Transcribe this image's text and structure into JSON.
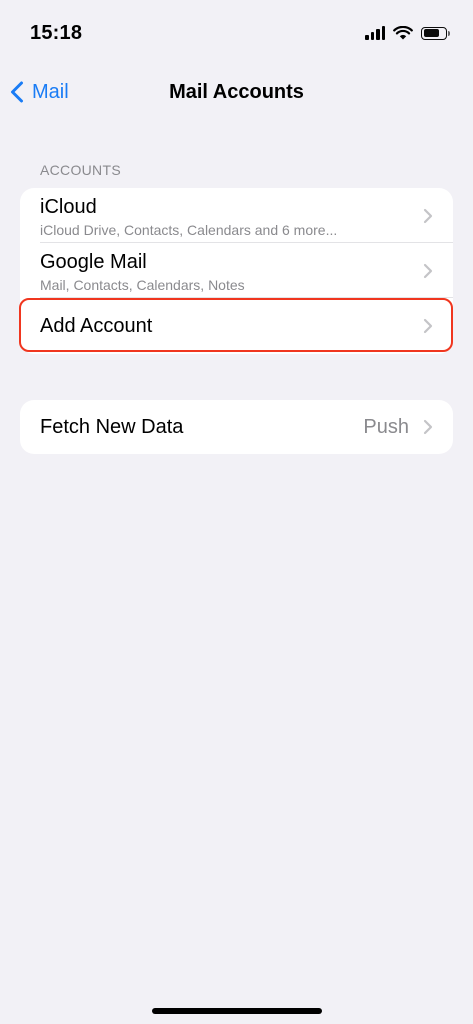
{
  "status_bar": {
    "time": "15:18",
    "icons": [
      "cellular-signal-icon",
      "wifi-icon",
      "battery-icon"
    ]
  },
  "nav": {
    "back_label": "Mail",
    "title": "Mail Accounts"
  },
  "accounts_section": {
    "header": "ACCOUNTS",
    "items": [
      {
        "title": "iCloud",
        "subtitle": "iCloud Drive, Contacts, Calendars and 6 more..."
      },
      {
        "title": "Google Mail",
        "subtitle": "Mail, Contacts, Calendars, Notes"
      },
      {
        "title": "Add Account"
      }
    ]
  },
  "fetch_section": {
    "title": "Fetch New Data",
    "value": "Push"
  },
  "colors": {
    "accent": "#1a7cf5",
    "background": "#f2f1f6",
    "highlight": "#f0361f",
    "secondary_text": "#8a8a8e"
  }
}
